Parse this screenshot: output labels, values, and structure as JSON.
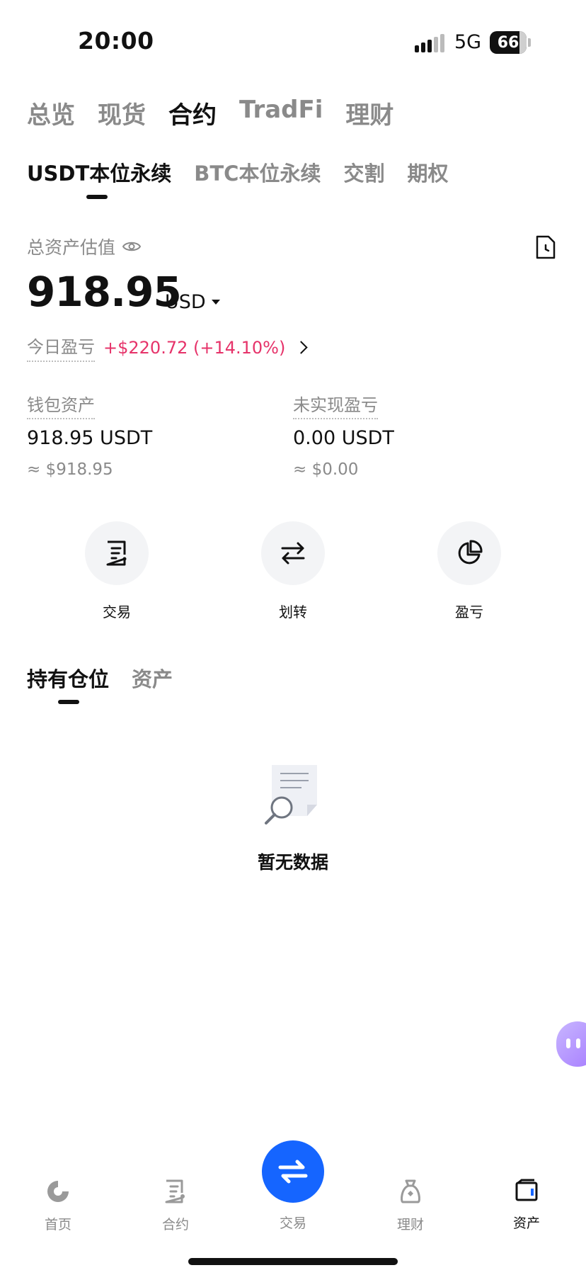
{
  "status_bar": {
    "time": "20:00",
    "network": "5G",
    "battery": "66"
  },
  "top_tabs": [
    {
      "label": "总览",
      "active": false
    },
    {
      "label": "现货",
      "active": false
    },
    {
      "label": "合约",
      "active": true
    },
    {
      "label": "TradFi",
      "active": false
    },
    {
      "label": "理财",
      "active": false
    }
  ],
  "sub_tabs": [
    {
      "label": "USDT本位永续",
      "active": true
    },
    {
      "label": "BTC本位永续",
      "active": false
    },
    {
      "label": "交割",
      "active": false
    },
    {
      "label": "期权",
      "active": false
    }
  ],
  "summary": {
    "total_label": "总资产估值",
    "total_amount": "918.95",
    "currency": "USD",
    "pnl_label": "今日盈亏",
    "pnl_value": "+$220.72 (+14.10%)"
  },
  "wallet": {
    "label": "钱包资产",
    "value": "918.95 USDT",
    "approx": "≈ $918.95"
  },
  "unrealized": {
    "label": "未实现盈亏",
    "value": "0.00 USDT",
    "approx": "≈ $0.00"
  },
  "actions": [
    {
      "label": "交易",
      "icon": "trade-doc-icon"
    },
    {
      "label": "划转",
      "icon": "transfer-icon"
    },
    {
      "label": "盈亏",
      "icon": "pie-chart-icon"
    }
  ],
  "position_tabs": [
    {
      "label": "持有仓位",
      "active": true
    },
    {
      "label": "资产",
      "active": false
    }
  ],
  "empty_state": {
    "text": "暂无数据",
    "icon": "empty-search-doc-icon"
  },
  "bottom_nav": [
    {
      "label": "首页",
      "icon": "home-logo-icon",
      "active": false
    },
    {
      "label": "合约",
      "icon": "contract-icon",
      "active": false
    },
    {
      "label": "交易",
      "icon": "swap-icon",
      "active": false
    },
    {
      "label": "理财",
      "icon": "finance-bag-icon",
      "active": false
    },
    {
      "label": "资产",
      "icon": "wallet-icon",
      "active": true
    }
  ],
  "colors": {
    "accent": "#1565ff",
    "profit": "#e6336a",
    "muted": "#8a8a8a"
  }
}
